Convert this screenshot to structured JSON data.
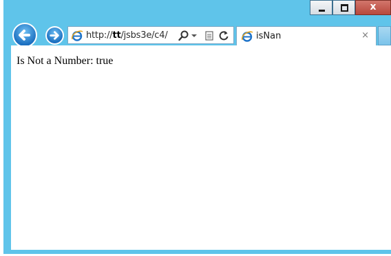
{
  "window": {
    "minimize_icon": "minimize-icon",
    "maximize_icon": "maximize-icon",
    "close_label": "x"
  },
  "nav": {
    "back_icon": "back-arrow-icon",
    "forward_icon": "forward-arrow-icon"
  },
  "address_bar": {
    "url_prefix": "http://",
    "url_host": "tt",
    "url_path": "/jsbs3e/c4/",
    "search_icon": "search-icon",
    "dropdown_icon": "dropdown-arrow-icon",
    "compat_icon": "compatibility-view-icon",
    "refresh_icon": "refresh-icon"
  },
  "tab": {
    "title": "isNan",
    "close_label": "×"
  },
  "page": {
    "text": "Is Not a Number: true"
  },
  "colors": {
    "frame": "#5fc4ea",
    "close_button": "#c0574b",
    "ie_blue": "#1e73c9"
  }
}
